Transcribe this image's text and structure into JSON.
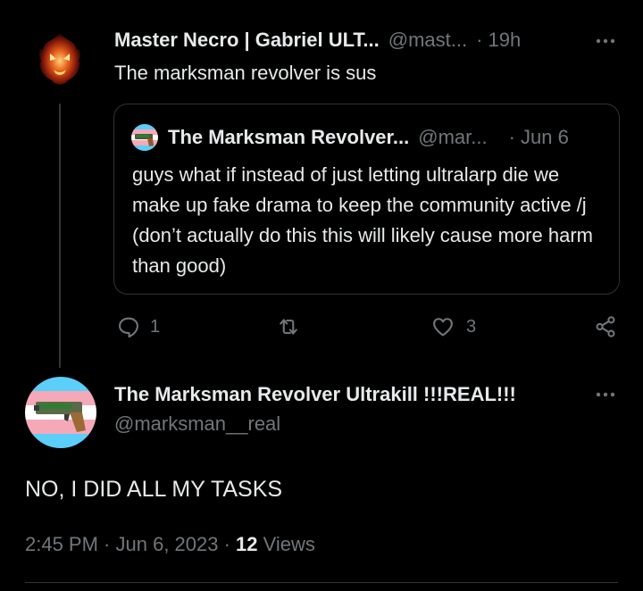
{
  "colors": {
    "background": "#000000",
    "text_primary": "#e7e9ea",
    "text_secondary": "#71767b",
    "border": "#2f3336",
    "trans_blue": "#5BCEFA",
    "trans_pink": "#F5A9B8",
    "trans_white": "#FFFFFF"
  },
  "parent_tweet": {
    "author_name": "Master Necro | Gabriel ULT...",
    "handle": "@mast...",
    "time": "· 19h",
    "text": "The marksman revolver is sus",
    "avatar_icon": "flaming-skull-avatar",
    "more_icon": "more-dots-icon",
    "quote": {
      "author_name": "The Marksman Revolver...",
      "handle": "@mar...",
      "time": "· Jun 6",
      "text": "guys what if instead of just letting ultralarp die we make up fake drama to keep the community active /j (don’t actually do this this will likely cause more harm than good)",
      "avatar_icon": "revolver-trans-flag-avatar"
    },
    "actions": {
      "reply_count": "1",
      "retweet_count": "",
      "like_count": "3",
      "reply_icon": "reply-icon",
      "retweet_icon": "retweet-icon",
      "like_icon": "heart-icon",
      "share_icon": "share-icon"
    }
  },
  "main_tweet": {
    "author_name": "The Marksman Revolver Ultrakill !!!REAL!!!",
    "handle": "@marksman__real",
    "text": "NO, I DID ALL MY TASKS",
    "avatar_icon": "revolver-trans-flag-avatar",
    "more_icon": "more-dots-icon",
    "meta": {
      "time": "2:45 PM",
      "sep1": " · ",
      "date": "Jun 6, 2023",
      "sep2": " · ",
      "views_count": "12",
      "views_label": " Views"
    }
  }
}
